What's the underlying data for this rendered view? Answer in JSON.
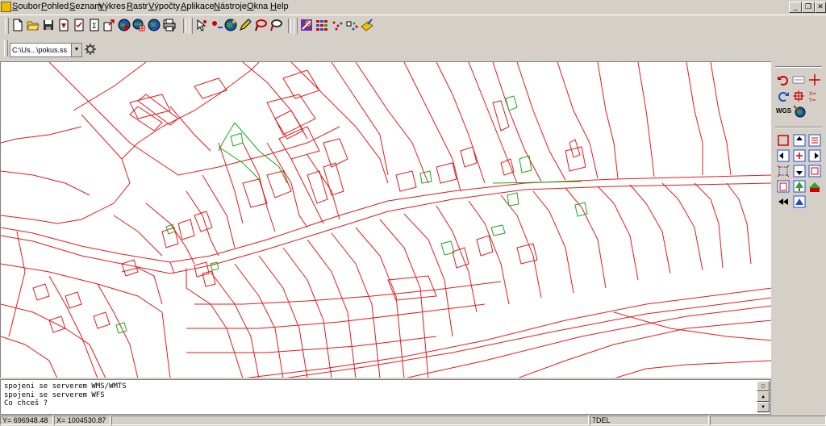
{
  "menu": {
    "items": [
      "Soubor",
      "Pohled",
      "Seznam",
      "Výkres",
      "Rastr",
      "Výpočty",
      "Aplikace",
      "Nástroje",
      "Okna",
      "Help"
    ],
    "underline_letters": [
      "S",
      "P",
      "S",
      "V",
      "R",
      "V",
      "A",
      "N",
      "O",
      "H"
    ]
  },
  "window_controls": {
    "minimize": "_",
    "restore": "❐",
    "close": "✕"
  },
  "toolbar": {
    "icons": [
      "new-file-icon",
      "open-folder-icon",
      "save-icon",
      "pdf-icon",
      "checklist-icon",
      "sigma-icon",
      "export-icon",
      "globe-red-icon",
      "grid-globe-icon",
      "globe-icon",
      "copy-icon",
      "print-icon",
      "cursor-points-icon",
      "red-dot-icon",
      "globe-network-icon",
      "pencil-icon",
      "lasso-red-icon",
      "lasso-dark-icon",
      "measure-icon",
      "color-grid-icon",
      "scatter-icon",
      "dots-icon",
      "map-arrow-icon"
    ]
  },
  "file_combo": {
    "value": "C:\\Us...\\pokus.ss"
  },
  "right_panel": {
    "icons": [
      "undo-icon",
      "note-icon",
      "crosshair-icon",
      "redo-icon",
      "snap-icon",
      "xy-coords-icon",
      "wgs-label",
      "tools-globe-icon",
      "select-rect-icon",
      "arrow-up-box-icon",
      "list-box-icon",
      "arrow-left-box-icon",
      "plus-box-icon",
      "arrow-right-box-icon",
      "bounds-icon",
      "arrow-down-box-icon",
      "zoom-box-icon",
      "doc-box-icon",
      "tree-icon",
      "green-layer-icon",
      "rewind-icon",
      "triangle-box-icon"
    ],
    "wgs_text": "WGS"
  },
  "command": {
    "lines": [
      "spojeni se serverem WMS/WMTS",
      "spojeni se serverem WFS",
      "Co chceš ?"
    ]
  },
  "status": {
    "y_label": "Y=",
    "y_value": "696948.48",
    "x_label": "X=",
    "x_value": "1004530.87",
    "mode": "7DEL"
  },
  "colors": {
    "parcel_lines": "#e31a1a",
    "building_outlines": "#1aa81a",
    "background": "#ffffff",
    "chrome": "#d4d0c8"
  }
}
